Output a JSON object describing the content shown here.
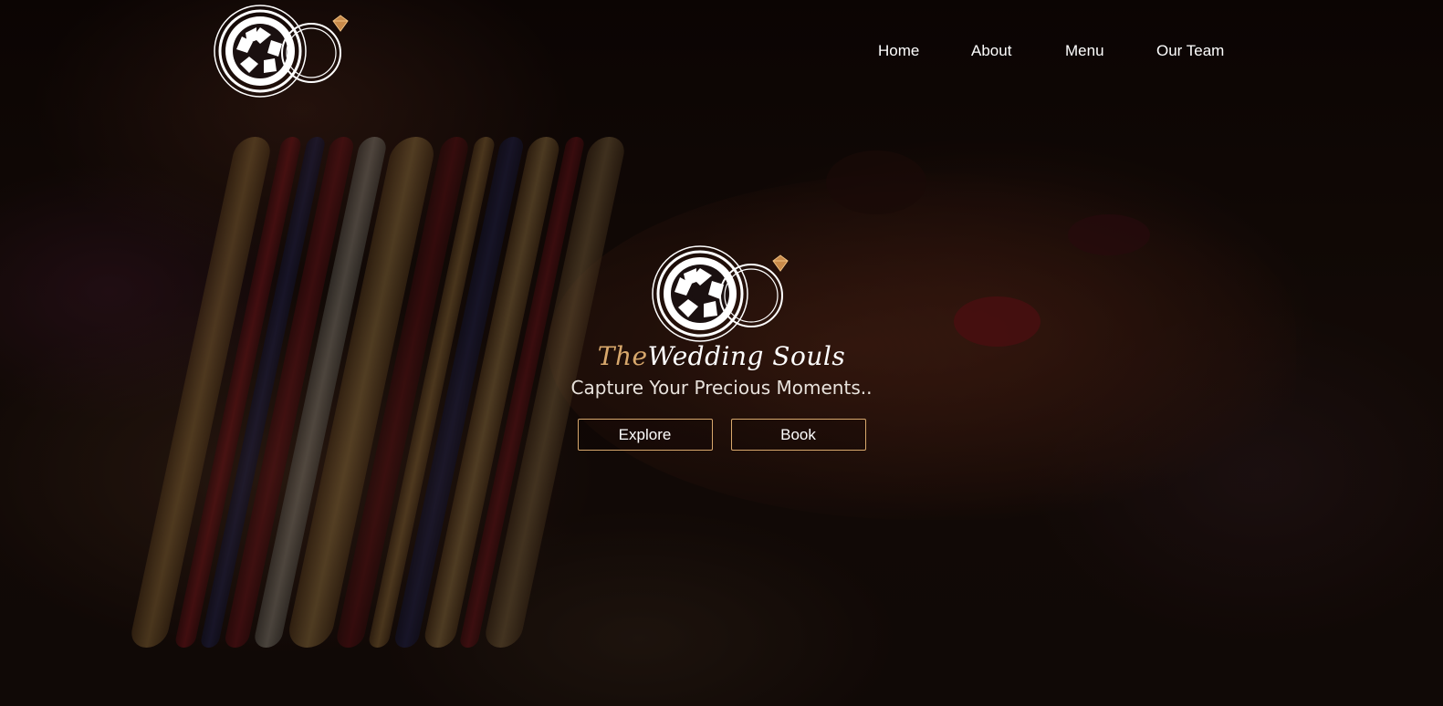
{
  "nav": {
    "items": [
      {
        "label": "Home"
      },
      {
        "label": "About"
      },
      {
        "label": "Menu"
      },
      {
        "label": "Our Team"
      }
    ]
  },
  "hero": {
    "brand_prefix": "The",
    "brand_name": "Wedding Souls",
    "tagline": "Capture Your Precious Moments..",
    "buttons": {
      "explore_label": "Explore",
      "book_label": "Book"
    }
  },
  "colors": {
    "accent_gold": "#d8a86c",
    "text": "#ffffff",
    "background": "#1a0e0a"
  },
  "icons": {
    "logo": "camera-aperture-rings-diamond-icon"
  }
}
